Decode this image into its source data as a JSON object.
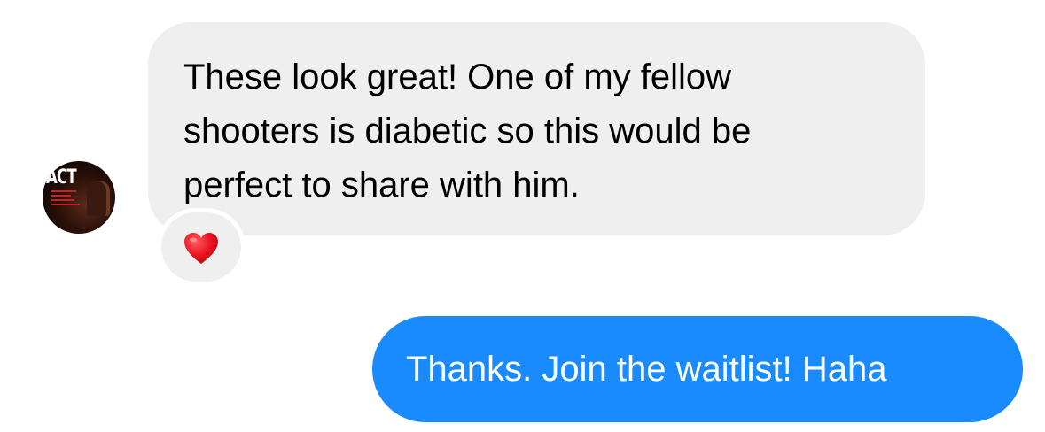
{
  "conversation": {
    "incoming": {
      "text": "These look great! One of my fellow shooters is diabetic so this would be perfect to share with him.",
      "lines": [
        "These look great! One of my fellow",
        "shooters is diabetic so this would be",
        "perfect to share with him."
      ],
      "reaction": "❤️",
      "avatar_label": "ACT"
    },
    "outgoing": {
      "text": "Thanks. Join the waitlist! Haha"
    }
  },
  "colors": {
    "incoming_bubble": "#efefef",
    "outgoing_bubble": "#1a8aff",
    "reaction_heart": "#e8121e"
  }
}
